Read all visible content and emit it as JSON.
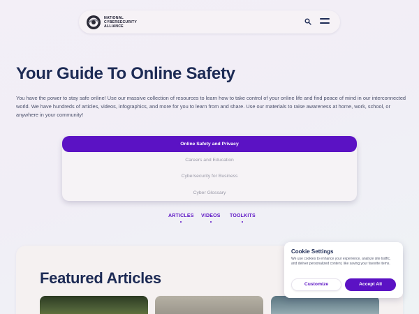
{
  "header": {
    "logo_lines": [
      "NATIONAL",
      "CYBERSECURITY",
      "ALLIANCE"
    ],
    "search_icon": "search-icon",
    "menu_icon": "hamburger-menu-icon"
  },
  "hero": {
    "title": "Your Guide To Online Safety",
    "intro": "You have the power to stay safe online! Use our massive collection of resources to learn how to take control of your online life and find peace of mind in our interconnected world. We have hundreds of articles, videos, infographics, and more for you to learn from and share. Use our materials to raise awareness at home, work, school, or anywhere in your community!"
  },
  "topics": [
    {
      "label": "Online Safety and Privacy",
      "active": true
    },
    {
      "label": "Careers and Education",
      "active": false
    },
    {
      "label": "Cybersecurity for Business",
      "active": false
    },
    {
      "label": "Cyber Glossary",
      "active": false
    }
  ],
  "subtabs": [
    "ARTICLES",
    "VIDEOS",
    "TOOLKITS"
  ],
  "featured": {
    "title": "Featured Articles"
  },
  "cookie": {
    "title": "Cookie Settings",
    "text": "We use cookies to enhance your experience, analyze site traffic, and deliver personalized content, like saving your favorite items.",
    "customize_label": "Customize",
    "accept_label": "Accept All"
  },
  "colors": {
    "accent": "#5b12c4",
    "heading": "#1d2b55"
  }
}
